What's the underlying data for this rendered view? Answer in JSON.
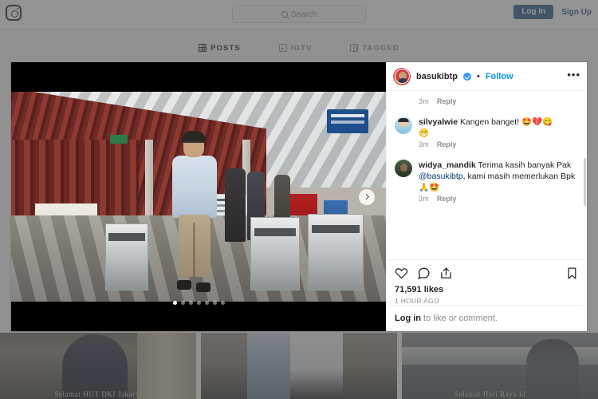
{
  "topnav": {
    "logo_icon": "instagram-camera-icon",
    "search": {
      "icon": "search-icon",
      "placeholder": "Search",
      "value": ""
    },
    "login_label": "Log In",
    "signup_label": "Sign Up",
    "accent_color": "#2b5c92"
  },
  "profile_tabs": [
    {
      "icon": "grid-icon",
      "label": "POSTS",
      "active": true
    },
    {
      "icon": "igtv-icon",
      "label": "IGTV",
      "active": false
    },
    {
      "icon": "tagged-icon",
      "label": "TAGGED",
      "active": false
    }
  ],
  "grid_thumbnails": [
    {
      "caption": "Selamat HUT DKI Jakarta"
    },
    {
      "caption": ""
    },
    {
      "caption": "Selamat Hari Raya Idulfitri"
    }
  ],
  "post": {
    "media": {
      "next_icon": "chevron-right-icon",
      "carousel_total": 7,
      "carousel_active": 1
    },
    "header": {
      "avatar": "user-avatar",
      "username": "basukibtp",
      "verified_icon": "verified-badge-icon",
      "separator": "•",
      "follow_label": "Follow",
      "more_icon": "more-options-icon",
      "more_glyph": "•••",
      "follow_color": "#0095f6"
    },
    "top_meta": {
      "time": "3m",
      "reply_label": "Reply"
    },
    "comments": [
      {
        "avatar": "commenter-avatar",
        "username": "silvyalwie",
        "text": " Kangen banget! ",
        "emoji": "🤩💔😋",
        "emoji2": "😁",
        "time": "3m",
        "reply_label": "Reply"
      },
      {
        "avatar": "commenter-avatar",
        "username": "widya_mandik",
        "text": " Terima kasih banyak Pak ",
        "mention": "@basukibtp",
        "text2": ", kami masih memerlukan Bpk ",
        "emoji": "🙏🤩",
        "time": "3m",
        "reply_label": "Reply"
      }
    ],
    "actions": {
      "like_icon": "heart-icon",
      "comment_icon": "comment-icon",
      "share_icon": "share-icon",
      "save_icon": "bookmark-icon"
    },
    "likes": "71,591 likes",
    "timestamp": "1 HOUR AGO",
    "login_prompt": {
      "link": "Log in",
      "rest": " to like or comment."
    }
  }
}
